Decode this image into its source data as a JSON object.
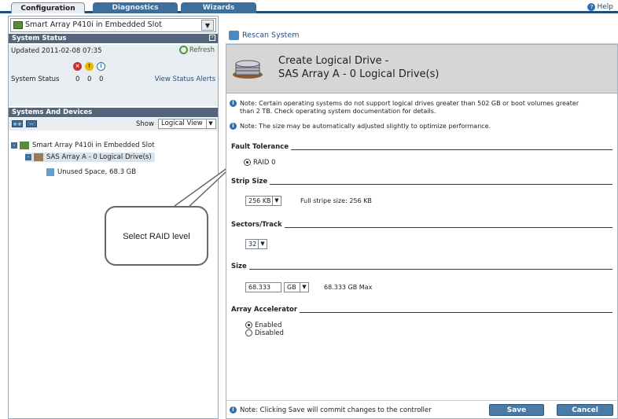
{
  "tabs": {
    "configuration": "Configuration",
    "diagnostics": "Diagnostics",
    "wizards": "Wizards",
    "help": "Help"
  },
  "controller_select": "Smart Array P410i in Embedded Slot",
  "rescan": "Rescan System",
  "system_status": {
    "header": "System Status",
    "updated": "Updated 2011-02-08 07:35",
    "refresh": "Refresh",
    "label": "System Status",
    "counts": [
      "0",
      "0",
      "0"
    ],
    "view_alerts": "View Status Alerts"
  },
  "systems_devices": {
    "header": "Systems And Devices",
    "expand_btn": "++",
    "collapse_btn": "--",
    "show_label": "Show",
    "view_value": "Logical View",
    "tree": [
      "Smart Array P410i in Embedded Slot",
      "SAS Array A - 0 Logical Drive(s)",
      "Unused Space, 68.3 GB"
    ]
  },
  "callout": "Select RAID level",
  "panel": {
    "title_line1": "Create Logical Drive -",
    "title_line2": "SAS Array A - 0 Logical Drive(s)",
    "note1_line1": "Note: Certain operating systems do not support logical drives greater than 502 GB or boot volumes greater",
    "note1_line2": "than 2 TB. Check operating system documentation for details.",
    "note2": "Note: The size may be automatically adjusted slightly to optimize performance.",
    "fault_tolerance": "Fault Tolerance",
    "raid_option": "RAID 0",
    "strip_size": "Strip Size",
    "strip_value": "256 KB",
    "full_stripe": "Full stripe size: 256 KB",
    "sectors_track": "Sectors/Track",
    "sectors_value": "32",
    "size": "Size",
    "size_value": "68.333",
    "size_unit": "GB",
    "size_max": "68.333 GB Max",
    "array_accelerator": "Array Accelerator",
    "enabled": "Enabled",
    "disabled": "Disabled",
    "footer_note": "Note: Clicking Save will commit changes to the controller",
    "save": "Save",
    "cancel": "Cancel"
  },
  "colors": {
    "nav": "#1d4e78",
    "section_head": "#52657a",
    "button": "#4a7aa6",
    "header_bg": "#d6d6d6"
  }
}
